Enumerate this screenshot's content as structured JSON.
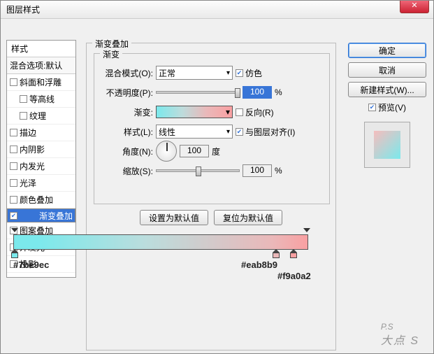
{
  "window": {
    "title": "图层样式"
  },
  "sidebar": {
    "header": "样式",
    "subheader": "混合选项:默认",
    "items": [
      {
        "label": "斜面和浮雕",
        "checked": false,
        "indent": false
      },
      {
        "label": "等高线",
        "checked": false,
        "indent": true
      },
      {
        "label": "纹理",
        "checked": false,
        "indent": true
      },
      {
        "label": "描边",
        "checked": false,
        "indent": false
      },
      {
        "label": "内阴影",
        "checked": false,
        "indent": false
      },
      {
        "label": "内发光",
        "checked": false,
        "indent": false
      },
      {
        "label": "光泽",
        "checked": false,
        "indent": false
      },
      {
        "label": "颜色叠加",
        "checked": false,
        "indent": false
      },
      {
        "label": "渐变叠加",
        "checked": true,
        "indent": false,
        "selected": true
      },
      {
        "label": "图案叠加",
        "checked": false,
        "indent": false
      },
      {
        "label": "外发光",
        "checked": false,
        "indent": false
      },
      {
        "label": "投影",
        "checked": false,
        "indent": false
      }
    ]
  },
  "main": {
    "group_title": "渐变叠加",
    "inner_title": "渐变",
    "blend_mode_label": "混合模式(O):",
    "blend_mode_value": "正常",
    "dither_label": "仿色",
    "dither_checked": true,
    "opacity_label": "不透明度(P):",
    "opacity_value": "100",
    "opacity_unit": "%",
    "gradient_label": "渐变:",
    "reverse_label": "反向(R)",
    "reverse_checked": false,
    "style_label": "样式(L):",
    "style_value": "线性",
    "align_label": "与图层对齐(I)",
    "align_checked": true,
    "angle_label": "角度(N):",
    "angle_value": "100",
    "angle_unit": "度",
    "scale_label": "缩放(S):",
    "scale_value": "100",
    "scale_unit": "%",
    "reset_default": "设置为默认值",
    "restore_default": "复位为默认值"
  },
  "gradient_stops": {
    "colors": [
      {
        "hex": "#7be9ec",
        "pos": 0
      },
      {
        "hex": "#eab8b9",
        "pos": 88
      },
      {
        "hex": "#f9a0a2",
        "pos": 100
      }
    ]
  },
  "buttons": {
    "ok": "确定",
    "cancel": "取消",
    "new_style": "新建样式(W)...",
    "preview_label": "预览(V)",
    "preview_checked": true
  },
  "watermark": {
    "big": "P.S",
    "small": "大点 S"
  }
}
